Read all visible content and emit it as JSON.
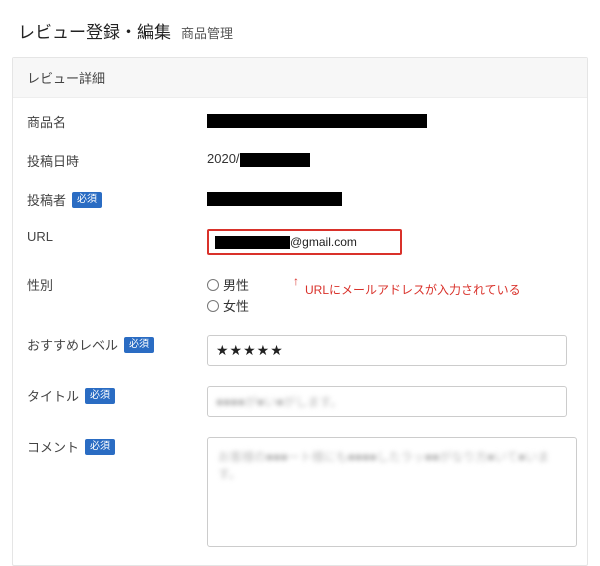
{
  "header": {
    "title": "レビュー登録・編集",
    "subtitle": "商品管理"
  },
  "panel": {
    "title": "レビュー詳細"
  },
  "labels": {
    "product_name": "商品名",
    "posted_at": "投稿日時",
    "poster": "投稿者",
    "url": "URL",
    "gender": "性別",
    "recommend": "おすすめレベル",
    "title_field": "タイトル",
    "comment": "コメント",
    "required": "必須"
  },
  "values": {
    "posted_at_prefix": "2020/",
    "url_suffix": "@gmail.com",
    "gender_options": {
      "male": "男性",
      "female": "女性"
    },
    "stars": "★★★★★",
    "title_placeholder": "■■■■が■い■がします。",
    "comment_placeholder": "お客様の■■■ート様にも■■■■したラッ■■がなり方■いて■います。"
  },
  "annotation": {
    "arrow": "↑",
    "text": "URLにメールアドレスが入力されている"
  },
  "colors": {
    "danger": "#d9312a",
    "badge": "#2a6cc3"
  }
}
